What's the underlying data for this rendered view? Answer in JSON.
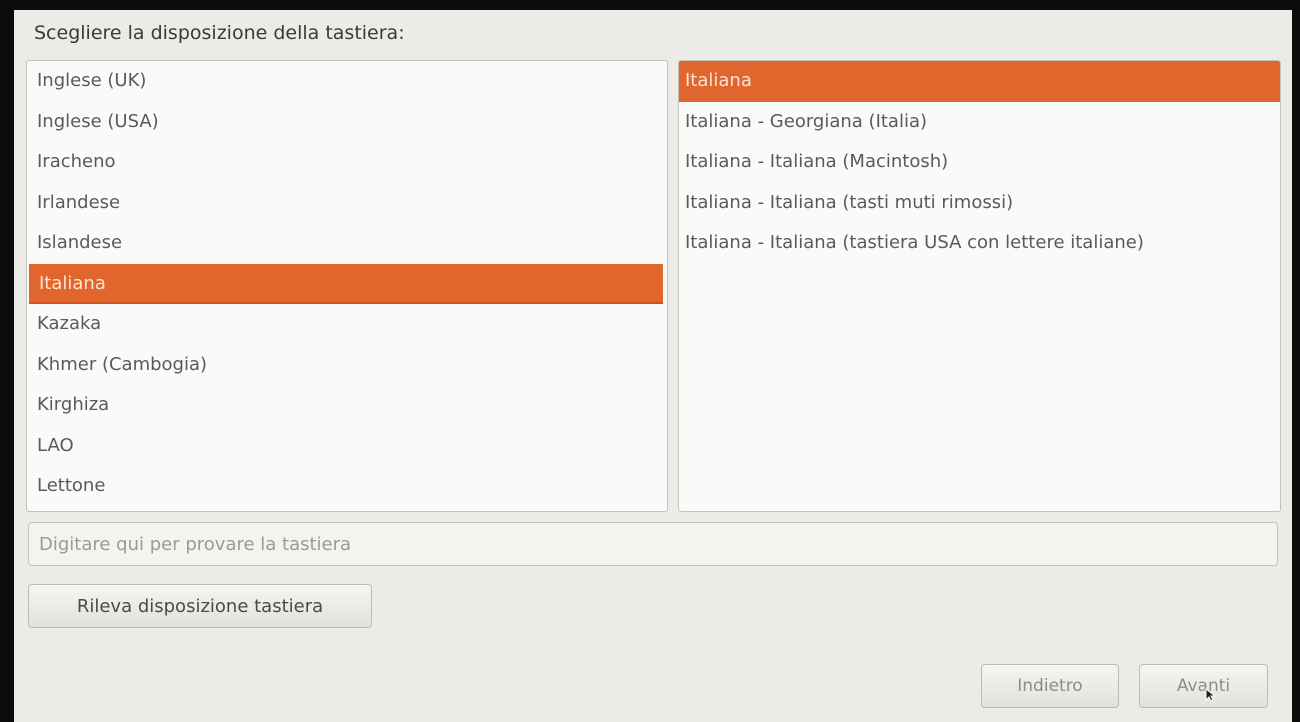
{
  "heading": "Scegliere la disposizione della tastiera:",
  "layouts": [
    {
      "label": "Inglese (UK)",
      "selected": false
    },
    {
      "label": "Inglese (USA)",
      "selected": false
    },
    {
      "label": "Iracheno",
      "selected": false
    },
    {
      "label": "Irlandese",
      "selected": false
    },
    {
      "label": "Islandese",
      "selected": false
    },
    {
      "label": "Italiana",
      "selected": true
    },
    {
      "label": "Kazaka",
      "selected": false
    },
    {
      "label": "Khmer (Cambogia)",
      "selected": false
    },
    {
      "label": "Kirghiza",
      "selected": false
    },
    {
      "label": "LAO",
      "selected": false
    },
    {
      "label": "Lettone",
      "selected": false
    }
  ],
  "variants": [
    {
      "label": "Italiana",
      "selected": true
    },
    {
      "label": "Italiana - Georgiana (Italia)",
      "selected": false
    },
    {
      "label": "Italiana - Italiana (Macintosh)",
      "selected": false
    },
    {
      "label": "Italiana - Italiana (tasti muti rimossi)",
      "selected": false
    },
    {
      "label": "Italiana - Italiana (tastiera USA con lettere italiane)",
      "selected": false
    }
  ],
  "test_field": {
    "placeholder": "Digitare qui per provare la tastiera",
    "value": ""
  },
  "buttons": {
    "detect": "Rileva disposizione tastiera",
    "back": "Indietro",
    "next": "Avanti"
  },
  "colors": {
    "accent": "#e0662e",
    "background": "#ecebe7"
  }
}
